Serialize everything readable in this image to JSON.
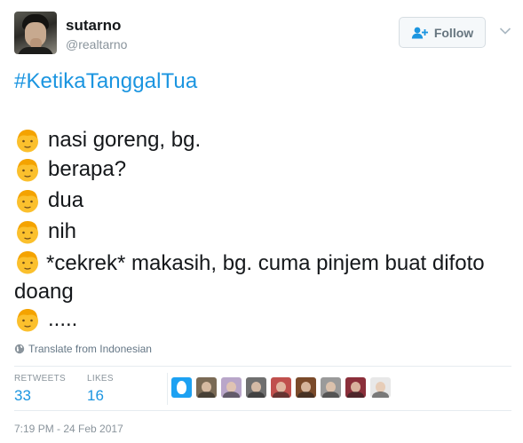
{
  "user": {
    "name": "sutarno",
    "handle": "@realtarno"
  },
  "follow_button": {
    "label": "Follow"
  },
  "tweet": {
    "hashtag": "#KetikaTanggalTua",
    "lines": [
      "nasi goreng, bg.",
      "berapa?",
      "dua",
      "nih",
      "*cekrek* makasih, bg. cuma pinjem buat difoto doang",
      "....."
    ],
    "emoji_icon": "boy-face-emoji"
  },
  "translate": {
    "label": "Translate from Indonesian",
    "icon": "globe-icon"
  },
  "stats": {
    "retweets_label": "RETWEETS",
    "retweets_value": "33",
    "likes_label": "LIKES",
    "likes_value": "16"
  },
  "likers": [
    {
      "name": "liker-avatar-1",
      "color": "#1da1f2"
    },
    {
      "name": "liker-avatar-2",
      "color": "#7a6a55"
    },
    {
      "name": "liker-avatar-3",
      "color": "#b9a6c9"
    },
    {
      "name": "liker-avatar-4",
      "color": "#6f6f6f"
    },
    {
      "name": "liker-avatar-5",
      "color": "#c0504d"
    },
    {
      "name": "liker-avatar-6",
      "color": "#7a4a2a"
    },
    {
      "name": "liker-avatar-7",
      "color": "#9a9a9a"
    },
    {
      "name": "liker-avatar-8",
      "color": "#8b2f3a"
    },
    {
      "name": "liker-avatar-9",
      "color": "#e8e8e8"
    }
  ],
  "timestamp": "7:19 PM - 24 Feb 2017",
  "colors": {
    "link": "#1b95e0",
    "text": "#14171a",
    "muted": "#8a949c"
  }
}
